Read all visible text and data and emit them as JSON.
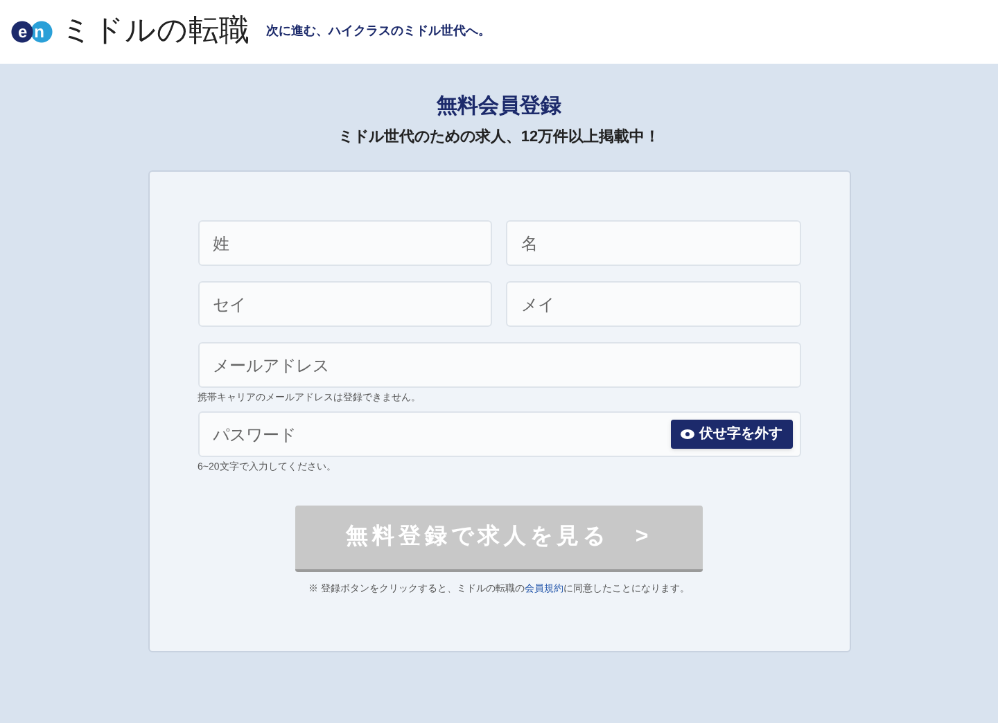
{
  "header": {
    "logo_mark": "en",
    "site_name": "ミドルの転職",
    "tagline": "次に進む、ハイクラスのミドル世代へ。"
  },
  "title": "無料会員登録",
  "subtitle": "ミドル世代のための求人、12万件以上掲載中！",
  "form": {
    "rows": [
      {
        "fields": [
          {
            "placeholder": "姓"
          },
          {
            "placeholder": "名"
          }
        ]
      },
      {
        "fields": [
          {
            "placeholder": "セイ"
          },
          {
            "placeholder": "メイ"
          }
        ]
      },
      {
        "fields": [
          {
            "placeholder": "メールアドレス"
          }
        ],
        "note": "携帯キャリアのメールアドレスは登録できません。"
      },
      {
        "fields": [
          {
            "placeholder": "パスワード",
            "toggle": "伏せ字を外す"
          }
        ],
        "note": "6~20文字で入力してください。"
      }
    ],
    "submit": {
      "label": "無料登録で求人を見る　>",
      "disabled": true
    },
    "agreement": {
      "before": "※ 登録ボタンをクリックすると、ミドルの転職の",
      "link": "会員規約",
      "after": "に同意したことになります。"
    }
  }
}
